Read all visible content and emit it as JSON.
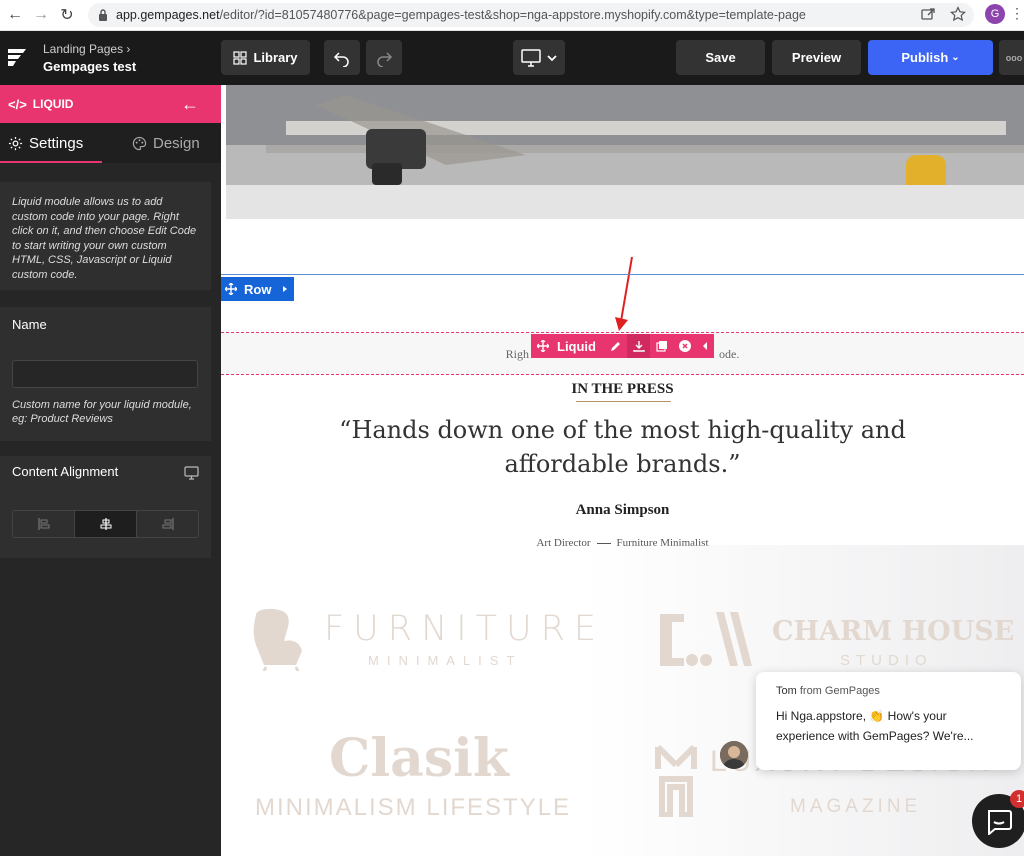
{
  "browser": {
    "url_host": "app.gempages.net",
    "url_path": "/editor/?id=81057480776&page=gempages-test&shop=nga-appstore.myshopify.com&type=template-page",
    "profile_initial": "G"
  },
  "topbar": {
    "breadcrumb_parent": "Landing Pages",
    "breadcrumb_sep": "›",
    "page_name": "Gempages test",
    "library_label": "Library",
    "save_label": "Save",
    "preview_label": "Preview",
    "publish_label": "Publish",
    "publish_caret": "⌄",
    "more_label": "ooo"
  },
  "panel": {
    "module_code": "</>",
    "module_title": "LIQUID",
    "back_glyph": "←",
    "tabs": [
      {
        "label": "Settings",
        "active": true
      },
      {
        "label": "Design",
        "active": false
      }
    ],
    "help_text": "Liquid module allows us to add custom code into your page. Right click on it, and then choose Edit Code to start writing your own custom HTML, CSS, Javascript or Liquid custom code.",
    "name_label": "Name",
    "name_value": "",
    "name_hint": "Custom name for your liquid module, eg: Product Reviews",
    "alignment_label": "Content Alignment",
    "alignment_selected": "center"
  },
  "canvas": {
    "row_label": "Row",
    "liquid_label": "Liquid",
    "liquid_text_left": "Righ",
    "liquid_text_right": "ode.",
    "press_title": "IN THE PRESS",
    "quote": "“Hands down one of the most high-quality and affordable brands.”",
    "author": "Anna Simpson",
    "role_left": "Art Director",
    "role_right": "Furniture Minimalist",
    "brands": [
      {
        "name": "FURNITURE",
        "tagline": "MINIMALIST"
      },
      {
        "name": "CHARM HOUSE",
        "tagline": "STUDIO"
      },
      {
        "name": "Clasik",
        "tagline": "MINIMALISM LIFESTYLE"
      },
      {
        "name": "LUXURY DESIGN",
        "tagline": "MAGAZINE"
      }
    ]
  },
  "chat": {
    "from_name": "Tom",
    "from_suffix": "from GemPages",
    "message": "Hi Nga.appstore, 👏 How's your experience with GemPages? We're...",
    "badge_count": "1"
  },
  "colors": {
    "accent": "#e8346f",
    "publish": "#3c64f5",
    "row": "#1565d8"
  }
}
